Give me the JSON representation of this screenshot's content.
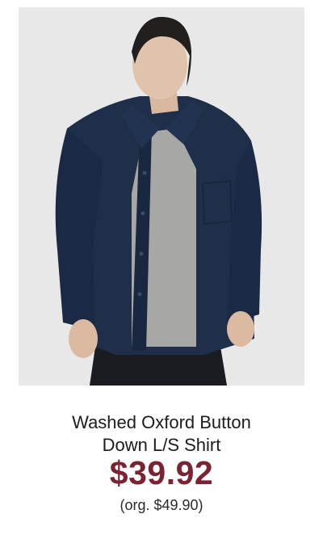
{
  "product": {
    "image_alt": "Model wearing navy washed oxford button down long sleeve shirt over grey t-shirt",
    "name_line1": "Washed Oxford Button",
    "name_line2": "Down L/S Shirt",
    "sale_price": "$39.92",
    "original_price": "(org. $49.90)"
  },
  "colors": {
    "background": "#e9e8e8",
    "shirt": "#1f2f4a",
    "tee": "#a7a7a5",
    "price": "#7a2333",
    "text": "#1c1c1c"
  }
}
